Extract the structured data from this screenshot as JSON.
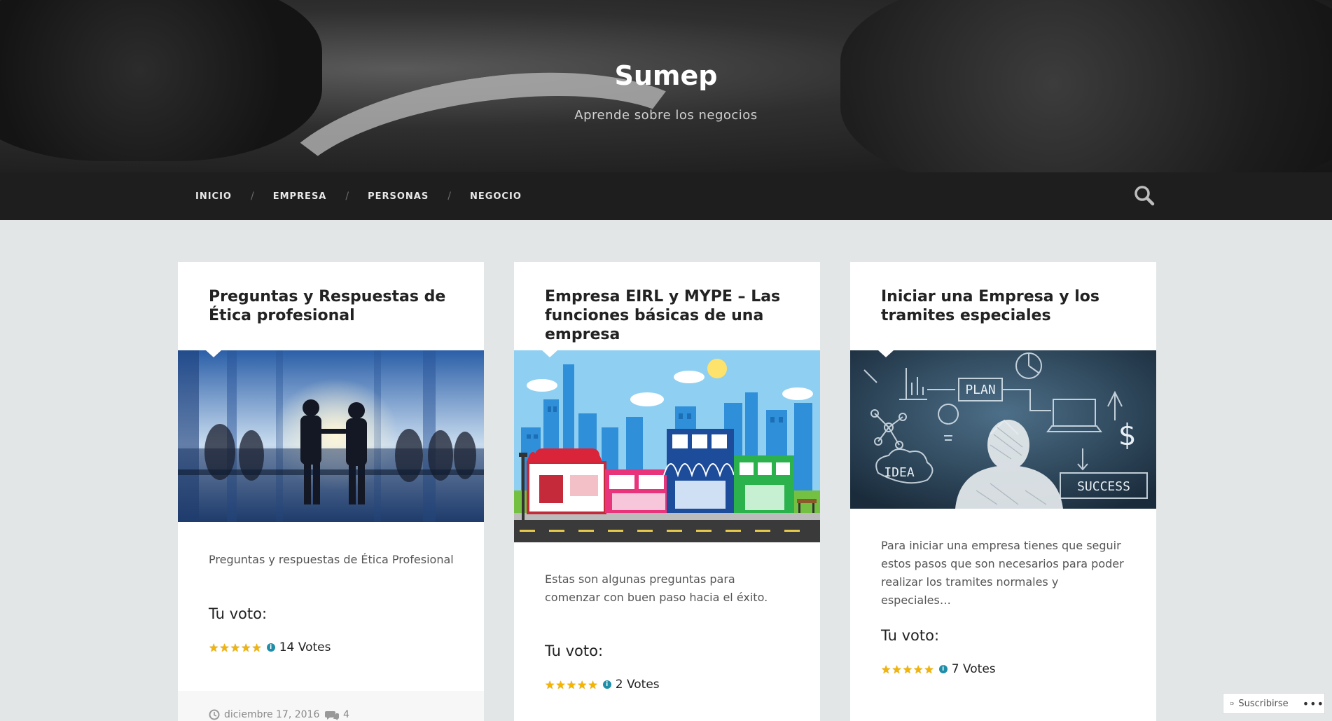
{
  "site": {
    "title": "Sumep",
    "description": "Aprende sobre los negocios"
  },
  "nav": {
    "items": [
      "INICIO",
      "EMPRESA",
      "PERSONAS",
      "NEGOCIO"
    ],
    "separator": "/"
  },
  "posts": [
    {
      "title": "Preguntas y Respuestas de Ética profesional",
      "excerpt": "Preguntas y respuestas de Ética Profesional",
      "vote_label": "Tu voto:",
      "rating_stars": 5,
      "votes": "14 Votes",
      "date": "diciembre 17, 2016",
      "comments": "4"
    },
    {
      "title": "Empresa EIRL y MYPE – Las funciones básicas de una empresa",
      "excerpt": "Estas son algunas preguntas para comenzar con buen paso hacia el éxito.",
      "vote_label": "Tu voto:",
      "rating_stars": 5,
      "votes": "2 Votes"
    },
    {
      "title": "Iniciar una Empresa y los tramites especiales",
      "excerpt": "Para iniciar una empresa tienes que seguir estos pasos que son necesarios para poder realizar los tramites normales y especiales…",
      "vote_label": "Tu voto:",
      "rating_stars": 5,
      "votes": "7 Votes"
    }
  ],
  "chalkboard_text": {
    "plan": "PLAN",
    "idea": "IDEA",
    "success": "SUCCESS",
    "dollar": "$"
  },
  "subscribe": {
    "label": "Suscribirse",
    "more": "•••"
  },
  "colors": {
    "page_bg": "#e3e6e6",
    "nav_bg": "#1e1e1e",
    "star": "#f4b400",
    "info_dot": "#1f8ea8"
  }
}
